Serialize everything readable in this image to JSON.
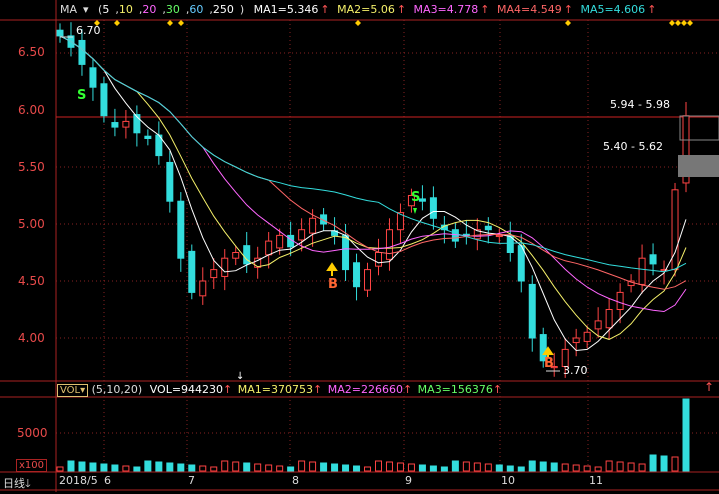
{
  "indicator_header": {
    "name": "MA",
    "params": "(5,10,20,30,60,250)",
    "param_values": [
      "5",
      "10",
      "20",
      "30",
      "60",
      "250"
    ],
    "param_colors": [
      "#ffffff",
      "#f5f06a",
      "#ff66ff",
      "#66ff66",
      "#66ccff",
      "#ffffff"
    ],
    "ma1": "MA1=5.346",
    "ma2": "MA2=5.06",
    "ma3": "MA3=4.778",
    "ma4": "MA4=4.549",
    "ma5": "MA5=4.606",
    "colors": {
      "ma1": "#ffffff",
      "ma2": "#f5f06a",
      "ma3": "#ff66ff",
      "ma4": "#ff6666",
      "ma5": "#33dddd"
    }
  },
  "volume_header": {
    "name": "VOL",
    "params": "(5,10,20)",
    "vol": "VOL=944230",
    "ma1": "MA1=370753",
    "ma2": "MA2=226660",
    "ma3": "MA3=156376"
  },
  "y_axis": {
    "ticks": [
      "6.50",
      "6.00",
      "5.50",
      "5.00",
      "4.50",
      "4.00"
    ],
    "tick_values": [
      6.5,
      6.0,
      5.5,
      5.0,
      4.5,
      4.0
    ]
  },
  "volume_axis": {
    "tick": "5000",
    "unit": "x100"
  },
  "x_axis": {
    "dates": [
      "2018/5",
      "6",
      "7",
      "8",
      "9",
      "10",
      "11"
    ],
    "period_menu": "日线"
  },
  "annotations": {
    "high": "6.70",
    "low": "3.70",
    "sell_signals": [
      "S",
      "S"
    ],
    "buy_signals": [
      "B",
      "B"
    ],
    "price_range_upper": "5.94 - 5.98",
    "price_range_lower": "5.40 - 5.62"
  },
  "chart_data": {
    "type": "candlestick",
    "title": "",
    "xlabel": "",
    "ylabel": "",
    "ylim": [
      3.7,
      6.75
    ],
    "x_categories": [
      "2018/5",
      "6",
      "7",
      "8",
      "9",
      "10",
      "11"
    ],
    "close_approx": [
      6.65,
      6.55,
      6.4,
      6.2,
      5.95,
      5.85,
      5.9,
      5.8,
      5.75,
      5.6,
      5.2,
      4.7,
      4.4,
      4.5,
      4.6,
      4.7,
      4.75,
      4.65,
      4.7,
      4.85,
      4.9,
      4.8,
      4.95,
      5.05,
      5.0,
      4.9,
      4.6,
      4.45,
      4.6,
      4.75,
      4.95,
      5.1,
      5.25,
      5.2,
      5.05,
      4.95,
      4.85,
      4.9,
      4.95,
      4.95,
      4.9,
      4.75,
      4.5,
      4.0,
      3.8,
      3.75,
      3.9,
      4.0,
      4.05,
      4.15,
      4.25,
      4.4,
      4.5,
      4.7,
      4.65,
      4.6,
      5.3,
      5.95
    ],
    "moving_averages": [
      {
        "name": "MA1",
        "value": 5.346
      },
      {
        "name": "MA2",
        "value": 5.06
      },
      {
        "name": "MA3",
        "value": 4.778
      },
      {
        "name": "MA4",
        "value": 4.549
      },
      {
        "name": "MA5",
        "value": 4.606
      }
    ],
    "volume_peak": 9442.3
  }
}
